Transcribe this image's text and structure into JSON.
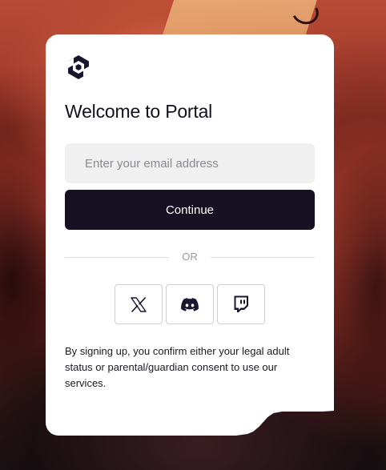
{
  "modal": {
    "title": "Welcome to Portal",
    "email_placeholder": "Enter your email address",
    "continue_label": "Continue",
    "divider_text": "OR",
    "social_buttons": [
      {
        "icon": "x-icon",
        "aria": "X"
      },
      {
        "icon": "discord-icon",
        "aria": "Discord"
      },
      {
        "icon": "twitch-icon",
        "aria": "Twitch"
      }
    ],
    "legal_text": "By signing up, you confirm either your legal adult status or parental/guardian consent to use our services."
  },
  "colors": {
    "primary_button": "#170f22",
    "input_background": "#f0f0f0",
    "text": "#14101f"
  }
}
